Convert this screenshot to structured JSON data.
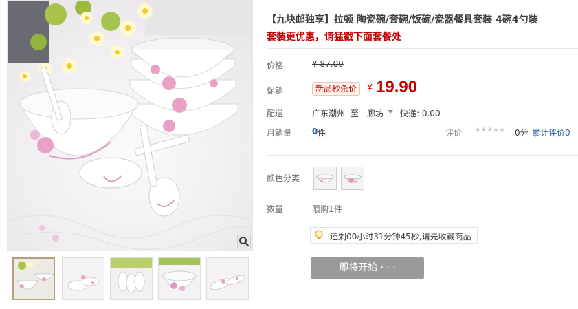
{
  "product": {
    "title": "【九块邮独享】拉顿 陶瓷碗/套碗/饭碗/瓷器餐具套装 4碗4勺装",
    "subtitle": "套装更优惠，请猛戳下面套餐处"
  },
  "price": {
    "label": "价格",
    "original": "¥ 87.00"
  },
  "promo": {
    "label": "促销",
    "badge": "新品秒杀价",
    "currency": "¥",
    "price": "19.90"
  },
  "shipping": {
    "label": "配送",
    "from": "广东潮州",
    "separator": "至",
    "to": "廊坊",
    "fee": "快递: 0.00"
  },
  "sales": {
    "label": "月销量",
    "count": "0",
    "unit": "件",
    "review_label": "评价",
    "stars": "★★★★★",
    "score": "0分",
    "review_link": "累计评价0"
  },
  "options": {
    "color_label": "颜色分类",
    "qty_label": "数量",
    "qty_limit": "限购1件"
  },
  "notice": {
    "text": "还剩00小时31分钟45秒,请先收藏商品"
  },
  "action": {
    "button": "即将开始 · · ·"
  },
  "colors": {
    "accent_red": "#c40000",
    "link_blue": "#2c5fa8",
    "button_gray": "#9a9a9a"
  },
  "icons": {
    "zoom": "magnifier-icon",
    "notice": "lightbulb-icon",
    "dropdown": "caret-down-icon"
  }
}
